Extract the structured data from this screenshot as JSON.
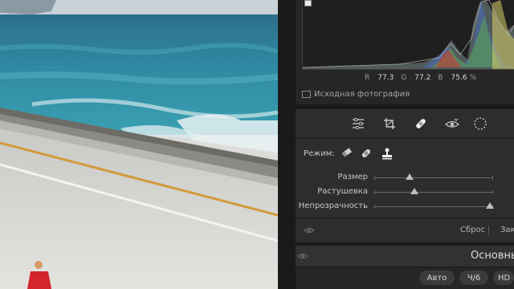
{
  "histogram": {
    "r_label": "R",
    "r_value": "77.3",
    "g_label": "G",
    "g_value": "77.2",
    "b_label": "B",
    "b_value": "75.6",
    "unit": "%"
  },
  "original_photo_label": "Исходная фотография",
  "toolbar": {
    "tools": [
      "sliders-icon",
      "crop-icon",
      "bandage-icon",
      "redeye-icon",
      "radial-mask-icon"
    ],
    "active_tool": "bandage-icon"
  },
  "brush": {
    "mode_label": "Режим:",
    "modes": [
      "eraser-icon",
      "heal-icon",
      "clone-stamp-icon"
    ],
    "active_mode": "clone-stamp-icon",
    "size_label": "Размер",
    "size_level": 0.3,
    "feather_label": "Растушевка",
    "feather_level": 0.34,
    "opacity_label": "Непрозрачность",
    "opacity_level": 0.97
  },
  "footer": {
    "reset_label": "Сброс",
    "close_label": "Зак"
  },
  "basic_panel": {
    "title": "Основны",
    "auto_label": "Авто",
    "bw_label": "Ч/6",
    "hdr_label": "HD"
  },
  "colors": {
    "panel_bg": "#2d2d2d",
    "accent": "#e8e8e8"
  }
}
